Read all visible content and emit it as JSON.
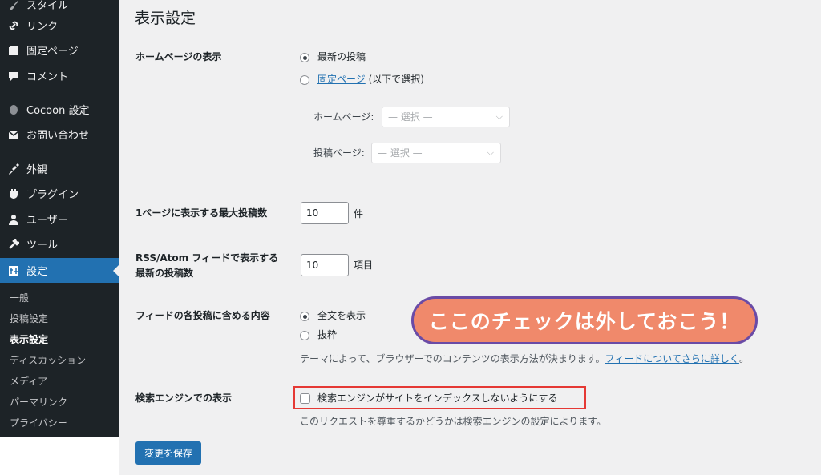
{
  "sidebar": {
    "items": [
      {
        "label": "スタイル",
        "icon": "brush-icon"
      },
      {
        "label": "リンク",
        "icon": "link-icon"
      },
      {
        "label": "固定ページ",
        "icon": "page-icon"
      },
      {
        "label": "コメント",
        "icon": "comment-icon"
      },
      {
        "label": "Cocoon 設定",
        "icon": "cocoon-icon"
      },
      {
        "label": "お問い合わせ",
        "icon": "mail-icon"
      },
      {
        "label": "外観",
        "icon": "appearance-icon"
      },
      {
        "label": "プラグイン",
        "icon": "plugin-icon"
      },
      {
        "label": "ユーザー",
        "icon": "user-icon"
      },
      {
        "label": "ツール",
        "icon": "wrench-icon"
      },
      {
        "label": "設定",
        "icon": "settings-icon"
      }
    ],
    "submenu": [
      "一般",
      "投稿設定",
      "表示設定",
      "ディスカッション",
      "メディア",
      "パーマリンク",
      "プライバシー"
    ],
    "current_submenu": "表示設定"
  },
  "page": {
    "title": "表示設定",
    "homepage": {
      "label": "ホームページの表示",
      "option_latest": "最新の投稿",
      "option_static_link": "固定ページ",
      "option_static_rest": " (以下で選択)",
      "homepage_label": "ホームページ:",
      "posts_page_label": "投稿ページ:",
      "select_placeholder": "— 選択 —"
    },
    "posts_per_page": {
      "label": "1ページに表示する最大投稿数",
      "value": "10",
      "unit": "件"
    },
    "feed_count": {
      "label_line1": "RSS/Atom フィードで表示する",
      "label_line2": "最新の投稿数",
      "value": "10",
      "unit": "項目"
    },
    "feed_content": {
      "label": "フィードの各投稿に含める内容",
      "option_full": "全文を表示",
      "option_excerpt": "抜粋",
      "desc_prefix": "テーマによって、ブラウザーでのコンテンツの表示方法が決まります。",
      "desc_link": "フィードについてさらに詳しく",
      "desc_suffix": "。"
    },
    "search_engine": {
      "label": "検索エンジンでの表示",
      "checkbox_label": "検索エンジンがサイトをインデックスしないようにする",
      "checked": false,
      "desc": "このリクエストを尊重するかどうかは検索エンジンの設定によります。"
    },
    "save_button": "変更を保存"
  },
  "annotation": {
    "callout_text": "ここのチェックは外しておこう！",
    "highlight_color": "#e53935"
  },
  "colors": {
    "accent": "#2271b1",
    "sidebar_bg": "#1d2327",
    "callout_bg": "#f0896b",
    "callout_border": "#6a4ba6"
  }
}
